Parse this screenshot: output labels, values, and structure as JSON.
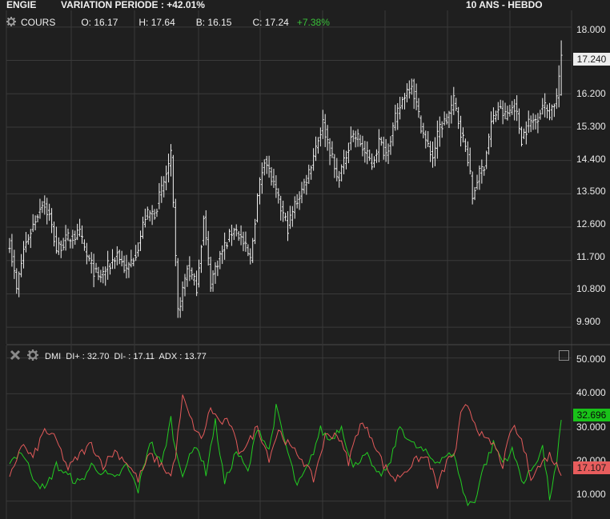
{
  "header": {
    "title": "ENGIE",
    "variation": "VARIATION PERIODE : +42.01%",
    "period": "10 ANS - HEBDO"
  },
  "price_panel": {
    "label": "COURS",
    "open": "O: 16.17",
    "high": "H: 17.64",
    "low": "B: 16.15",
    "close": "C: 17.24",
    "change": "+7.38%",
    "last_price": "17.240",
    "y_ticks": [
      "18.000",
      "17.100",
      "16.200",
      "15.300",
      "14.400",
      "13.500",
      "12.600",
      "11.700",
      "10.800",
      "9.900"
    ]
  },
  "indicator_panel": {
    "label": "DMI  DI+ : 32.70  DI- : 17.11  ADX : 13.77",
    "di_plus_tag": "32.696",
    "di_minus_tag": "17.107",
    "y_ticks": [
      "50.000",
      "40.000",
      "30.000",
      "20.000",
      "10.000"
    ]
  },
  "icons": {
    "settings": "gear-icon",
    "close": "close-icon",
    "maximize": "maximize-icon"
  },
  "colors": {
    "background": "#1f1f1f",
    "grid": "#3a3a3a",
    "bars": "#f0f0f0",
    "di_plus": "#22cc22",
    "di_minus": "#e35a5a",
    "change_up": "#3ac13a"
  },
  "chart_data": [
    {
      "type": "ohlc",
      "series_name": "COURS",
      "ylim": [
        9.45,
        18.45
      ],
      "y_ticks": [
        18.0,
        17.1,
        16.2,
        15.3,
        14.4,
        13.5,
        12.6,
        11.7,
        10.8,
        9.9
      ],
      "last_close": 17.24,
      "anchors_close": [
        [
          0,
          12.2
        ],
        [
          3,
          10.9
        ],
        [
          6,
          12.0
        ],
        [
          9,
          12.5
        ],
        [
          14,
          13.3
        ],
        [
          17,
          12.9
        ],
        [
          20,
          12.0
        ],
        [
          25,
          12.3
        ],
        [
          30,
          12.4
        ],
        [
          33,
          11.8
        ],
        [
          38,
          11.2
        ],
        [
          43,
          11.6
        ],
        [
          46,
          11.9
        ],
        [
          50,
          11.4
        ],
        [
          55,
          12.1
        ],
        [
          58,
          12.9
        ],
        [
          62,
          13.0
        ],
        [
          66,
          13.8
        ],
        [
          69,
          14.5
        ],
        [
          72,
          10.3
        ],
        [
          76,
          11.5
        ],
        [
          80,
          11.0
        ],
        [
          83,
          12.8
        ],
        [
          86,
          11.1
        ],
        [
          89,
          11.7
        ],
        [
          93,
          12.2
        ],
        [
          96,
          12.6
        ],
        [
          99,
          12.3
        ],
        [
          103,
          11.7
        ],
        [
          106,
          13.4
        ],
        [
          109,
          14.5
        ],
        [
          112,
          13.9
        ],
        [
          116,
          13.1
        ],
        [
          119,
          12.6
        ],
        [
          122,
          13.2
        ],
        [
          125,
          13.6
        ],
        [
          128,
          14.1
        ],
        [
          131,
          14.8
        ],
        [
          134,
          15.4
        ],
        [
          137,
          14.7
        ],
        [
          140,
          13.9
        ],
        [
          143,
          14.3
        ],
        [
          146,
          15.1
        ],
        [
          149,
          15.0
        ],
        [
          152,
          14.6
        ],
        [
          155,
          14.3
        ],
        [
          158,
          14.9
        ],
        [
          161,
          14.6
        ],
        [
          165,
          15.5
        ],
        [
          169,
          16.2
        ],
        [
          172,
          16.5
        ],
        [
          175,
          15.6
        ],
        [
          178,
          14.9
        ],
        [
          181,
          14.5
        ],
        [
          184,
          15.3
        ],
        [
          187,
          15.5
        ],
        [
          190,
          16.0
        ],
        [
          193,
          15.2
        ],
        [
          196,
          14.5
        ],
        [
          198,
          13.4
        ],
        [
          200,
          13.9
        ],
        [
          203,
          14.3
        ],
        [
          206,
          15.4
        ],
        [
          209,
          15.8
        ],
        [
          212,
          15.6
        ],
        [
          216,
          15.9
        ],
        [
          219,
          15.0
        ],
        [
          222,
          15.4
        ],
        [
          225,
          15.5
        ],
        [
          228,
          15.9
        ],
        [
          231,
          15.7
        ],
        [
          234,
          16.1
        ],
        [
          236,
          17.24
        ]
      ]
    },
    {
      "type": "line",
      "ylim": [
        5.0,
        53.5
      ],
      "y_ticks": [
        50,
        40,
        30,
        20,
        10
      ],
      "series": [
        {
          "name": "DI+",
          "last": 32.7,
          "anchors": [
            [
              0,
              21
            ],
            [
              5,
              24
            ],
            [
              10,
              17
            ],
            [
              15,
              13
            ],
            [
              20,
              20
            ],
            [
              25,
              17
            ],
            [
              30,
              15
            ],
            [
              35,
              20
            ],
            [
              40,
              18
            ],
            [
              45,
              16
            ],
            [
              50,
              20
            ],
            [
              55,
              13
            ],
            [
              60,
              27
            ],
            [
              65,
              20
            ],
            [
              69,
              33
            ],
            [
              71,
              24
            ],
            [
              74,
              18
            ],
            [
              80,
              26
            ],
            [
              84,
              18
            ],
            [
              88,
              32
            ],
            [
              92,
              15
            ],
            [
              97,
              24
            ],
            [
              102,
              18
            ],
            [
              106,
              31
            ],
            [
              111,
              24
            ],
            [
              114,
              36
            ],
            [
              118,
              26
            ],
            [
              123,
              14
            ],
            [
              128,
              20
            ],
            [
              133,
              30
            ],
            [
              137,
              27
            ],
            [
              142,
              31
            ],
            [
              147,
              19
            ],
            [
              152,
              24
            ],
            [
              157,
              17
            ],
            [
              162,
              19
            ],
            [
              167,
              31
            ],
            [
              172,
              26
            ],
            [
              177,
              24
            ],
            [
              182,
              21
            ],
            [
              187,
              23
            ],
            [
              191,
              22
            ],
            [
              193,
              15
            ],
            [
              196,
              9
            ],
            [
              199,
              10
            ],
            [
              202,
              18
            ],
            [
              207,
              26
            ],
            [
              211,
              21
            ],
            [
              215,
              24
            ],
            [
              220,
              15
            ],
            [
              225,
              21
            ],
            [
              228,
              25
            ],
            [
              231,
              11
            ],
            [
              234,
              20
            ],
            [
              236,
              32.7
            ]
          ]
        },
        {
          "name": "DI-",
          "last": 17.11,
          "anchors": [
            [
              0,
              16
            ],
            [
              5,
              26
            ],
            [
              10,
              22
            ],
            [
              15,
              30
            ],
            [
              20,
              27
            ],
            [
              25,
              19
            ],
            [
              30,
              23
            ],
            [
              35,
              26
            ],
            [
              40,
              20
            ],
            [
              45,
              24
            ],
            [
              50,
              21
            ],
            [
              55,
              16
            ],
            [
              60,
              23
            ],
            [
              65,
              20
            ],
            [
              69,
              17
            ],
            [
              71,
              23
            ],
            [
              74,
              39
            ],
            [
              78,
              32
            ],
            [
              82,
              27
            ],
            [
              86,
              36
            ],
            [
              90,
              32
            ],
            [
              94,
              32
            ],
            [
              98,
              24
            ],
            [
              102,
              26
            ],
            [
              106,
              31
            ],
            [
              111,
              22
            ],
            [
              115,
              30
            ],
            [
              120,
              25
            ],
            [
              125,
              22
            ],
            [
              130,
              16
            ],
            [
              135,
              28
            ],
            [
              140,
              29
            ],
            [
              145,
              21
            ],
            [
              150,
              32
            ],
            [
              155,
              28
            ],
            [
              160,
              20
            ],
            [
              165,
              16
            ],
            [
              170,
              19
            ],
            [
              175,
              22
            ],
            [
              179,
              22
            ],
            [
              183,
              14
            ],
            [
              187,
              21
            ],
            [
              191,
              24
            ],
            [
              193,
              34
            ],
            [
              196,
              37
            ],
            [
              199,
              32
            ],
            [
              203,
              27
            ],
            [
              207,
              26
            ],
            [
              211,
              20
            ],
            [
              215,
              31
            ],
            [
              219,
              27
            ],
            [
              223,
              17
            ],
            [
              227,
              20
            ],
            [
              231,
              23
            ],
            [
              234,
              20
            ],
            [
              236,
              17.11
            ]
          ]
        },
        {
          "name": "ADX",
          "last": 13.77,
          "anchors": []
        }
      ]
    }
  ]
}
